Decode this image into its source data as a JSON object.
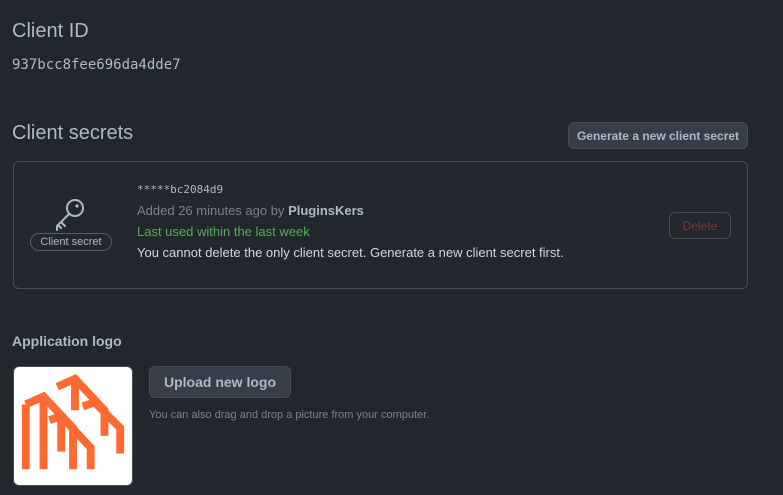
{
  "client_id": {
    "heading": "Client ID",
    "value": "937bcc8fee696da4dde7"
  },
  "client_secrets": {
    "heading": "Client secrets",
    "generate_button": "Generate a new client secret",
    "secret": {
      "icon": "key-icon",
      "label": "Client secret",
      "masked_value": "*****bc2084d9",
      "added_prefix": "Added 26 minutes ago by",
      "added_by": "PluginsKers",
      "last_used": "Last used within the last week",
      "warning": "You cannot delete the only client secret. Generate a new client secret first.",
      "delete_button": "Delete"
    }
  },
  "application_logo": {
    "heading": "Application logo",
    "upload_button": "Upload new logo",
    "hint": "You can also drag and drop a picture from your computer.",
    "logo_color": "#ff6a33"
  },
  "colors": {
    "background": "#22272e",
    "border": "#444c56",
    "success": "#57ab5a",
    "danger_muted": "#7a3a39"
  }
}
